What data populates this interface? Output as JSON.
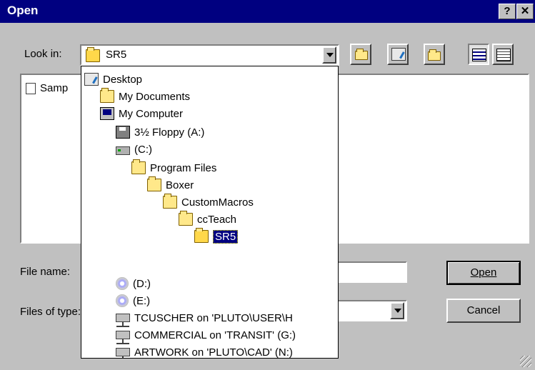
{
  "window": {
    "title": "Open",
    "help_btn": "?",
    "close_btn": "✕"
  },
  "look_in": {
    "label": "Look in:",
    "value": "SR5",
    "arrow": "▾"
  },
  "file_list": [
    {
      "name": "Samp"
    }
  ],
  "file_name": {
    "label": "File name:",
    "value": ""
  },
  "files_of_type": {
    "label": "Files of type:",
    "value": ""
  },
  "buttons": {
    "open": "Open",
    "cancel": "Cancel"
  },
  "dropdown_items": [
    {
      "label": "Desktop",
      "icon": "desktop-icon"
    },
    {
      "label": "My Documents",
      "icon": "folder-icon"
    },
    {
      "label": "My Computer",
      "icon": "computer-icon"
    },
    {
      "label": "3½ Floppy (A:)",
      "icon": "floppy-icon"
    },
    {
      "label": "(C:)",
      "icon": "hard-drive-icon"
    },
    {
      "label": "Program Files",
      "icon": "folder-icon"
    },
    {
      "label": "Boxer",
      "icon": "folder-icon"
    },
    {
      "label": "CustomMacros",
      "icon": "folder-icon"
    },
    {
      "label": "ccTeach",
      "icon": "folder-icon"
    },
    {
      "label": "SR5",
      "icon": "open-folder-icon",
      "selected": true
    },
    {
      "label": "(D:)",
      "icon": "cd-drive-icon"
    },
    {
      "label": "(E:)",
      "icon": "cd-drive-icon"
    },
    {
      "label": "TCUSCHER on 'PLUTO\\USER\\H",
      "icon": "network-drive-icon"
    },
    {
      "label": "COMMERCIAL on 'TRANSIT' (G:)",
      "icon": "network-drive-icon"
    },
    {
      "label": "ARTWORK on 'PLUTO\\CAD' (N:)",
      "icon": "network-drive-icon"
    }
  ]
}
